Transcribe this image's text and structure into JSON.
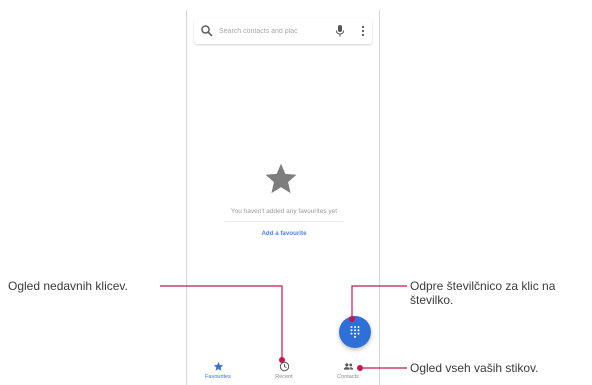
{
  "search": {
    "placeholder": "Search contacts and plac",
    "icon": "search-icon",
    "mic_icon": "mic-icon",
    "more_icon": "more-vert-icon"
  },
  "favourites": {
    "empty_icon": "star-icon",
    "empty_message": "You haven't added any favourites yet",
    "add_link": "Add a favourite"
  },
  "fab": {
    "icon": "dialpad-icon",
    "color": "#2f6fd8"
  },
  "nav": {
    "items": [
      {
        "label": "Favourites",
        "icon": "star-icon",
        "active": true
      },
      {
        "label": "Recent",
        "icon": "clock-icon",
        "active": false
      },
      {
        "label": "Contacts",
        "icon": "people-icon",
        "active": false
      }
    ]
  },
  "callouts": {
    "recent": "Ogled nedavnih klicev.",
    "dialpad_line1": "Odpre številčnico za klic na",
    "dialpad_line2": "številko.",
    "contacts": "Ogled vseh vaših stikov."
  },
  "colors": {
    "accent": "#3a6fd6",
    "callout_line": "#c6174a"
  }
}
